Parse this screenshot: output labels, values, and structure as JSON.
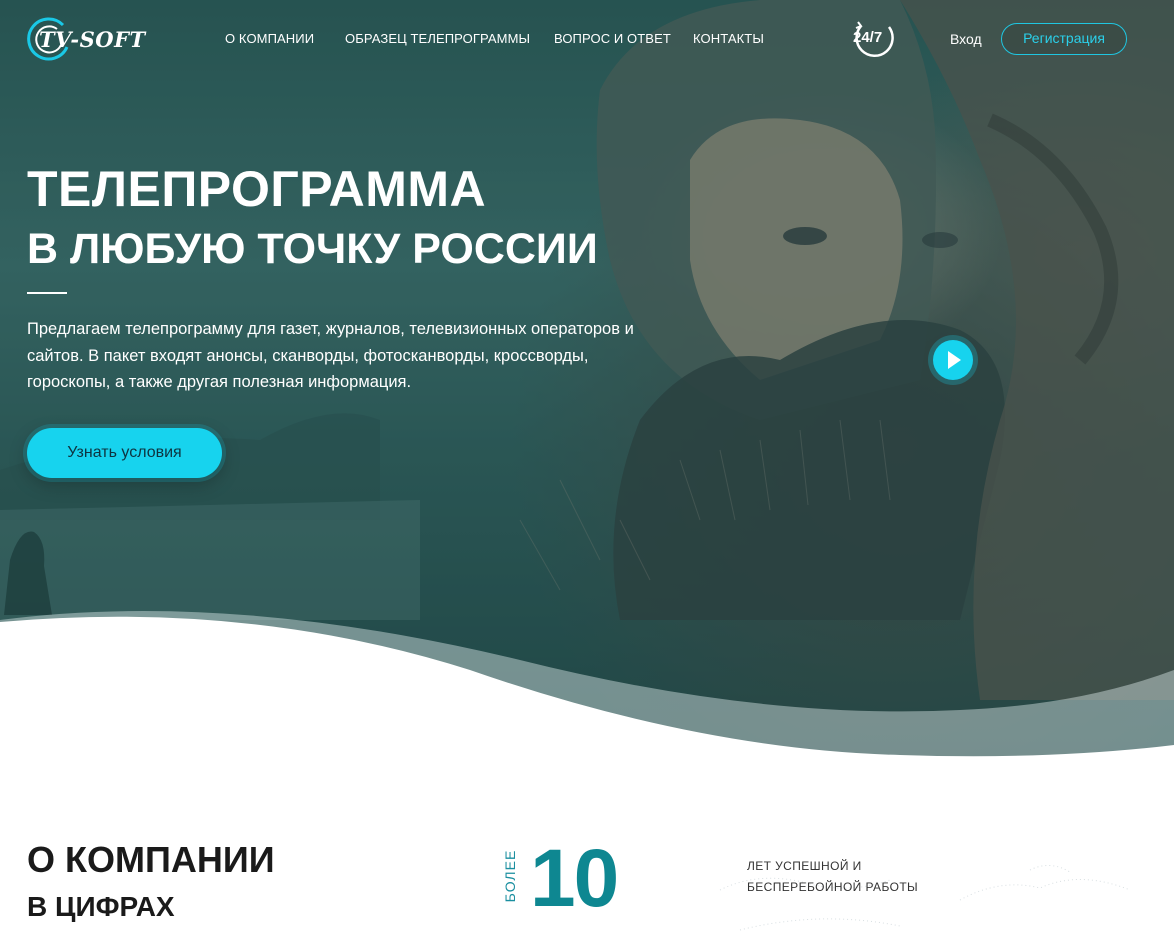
{
  "header": {
    "logo_text": "TV-SOFT",
    "nav": [
      {
        "label": "О КОМПАНИИ"
      },
      {
        "label": "ОБРАЗЕЦ ТЕЛЕПРОГРАММЫ"
      },
      {
        "label": "ВОПРОС И ОТВЕТ"
      },
      {
        "label": "КОНТАКТЫ"
      }
    ],
    "badge_text": "24/7",
    "login_label": "Вход",
    "register_label": "Регистрация"
  },
  "hero": {
    "title": "ТЕЛЕПРОГРАММА",
    "subtitle": "В ЛЮБУЮ ТОЧКУ РОССИИ",
    "description": "Предлагаем телепрограмму для газет, журналов, телевизионных операторов и сайтов. В пакет входят анонсы, сканворды, фотосканворды, кроссворды, гороскопы, а также другая полезная информация.",
    "cta_label": "Узнать условия",
    "play_icon": "play-icon"
  },
  "about": {
    "title": "О КОМПАНИИ",
    "subtitle": "В ЦИФРАХ",
    "stat_prefix": "БОЛЕЕ",
    "stat_value": "10",
    "stat_caption": "ЛЕТ УСПЕШНОЙ И БЕСПЕРЕБОЙНОЙ РАБОТЫ"
  },
  "colors": {
    "accent": "#17d3ee",
    "stat_teal": "#0e8791",
    "hero_bg": "#2e5654"
  }
}
